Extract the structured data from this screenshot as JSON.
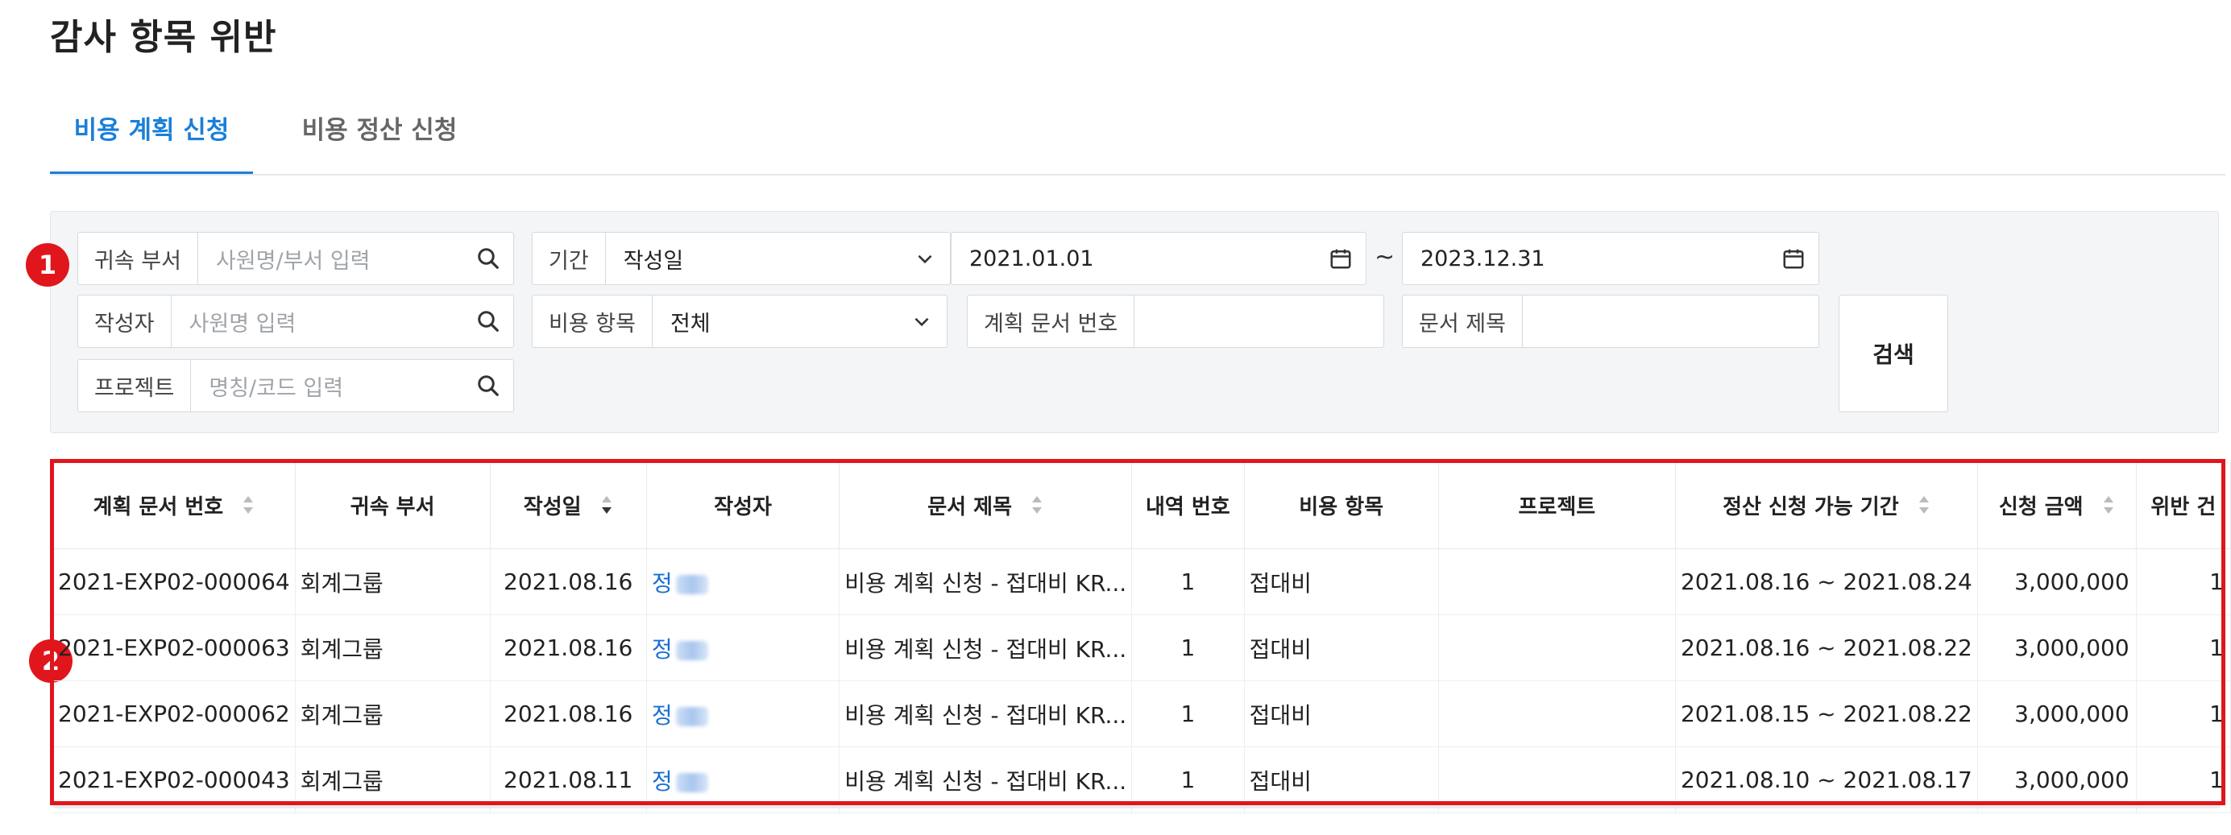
{
  "page": {
    "title": "감사 항목 위반"
  },
  "tabs": [
    {
      "label": "비용 계획 신청",
      "active": true
    },
    {
      "label": "비용 정산 신청",
      "active": false
    }
  ],
  "filters": {
    "department": {
      "label": "귀속 부서",
      "placeholder": "사원명/부서 입력"
    },
    "period": {
      "label": "기간",
      "type_value": "작성일",
      "start": "2021.01.01",
      "end": "2023.12.31",
      "separator": "~"
    },
    "author": {
      "label": "작성자",
      "placeholder": "사원명 입력"
    },
    "expense_item": {
      "label": "비용 항목",
      "value": "전체"
    },
    "plan_doc_no": {
      "label": "계획 문서 번호",
      "value": ""
    },
    "doc_title": {
      "label": "문서 제목",
      "value": ""
    },
    "project": {
      "label": "프로젝트",
      "placeholder": "명칭/코드 입력"
    },
    "search_button": "검색"
  },
  "annotations": {
    "badge1": "1",
    "badge2": "2"
  },
  "table": {
    "columns": [
      "계획 문서 번호",
      "귀속 부서",
      "작성일",
      "작성자",
      "문서 제목",
      "내역 번호",
      "비용 항목",
      "프로젝트",
      "정산 신청 가능 기간",
      "신청 금액",
      "위반 건"
    ],
    "rows": [
      {
        "doc_no": "2021-EXP02-000064",
        "dept": "회계그룹",
        "date": "2021.08.16",
        "author": "정",
        "title": "비용 계획 신청 - 접대비 KR...",
        "line_no": "1",
        "expense": "접대비",
        "project": "",
        "period": "2021.08.16 ~ 2021.08.24",
        "amount": "3,000,000",
        "violations": "1"
      },
      {
        "doc_no": "2021-EXP02-000063",
        "dept": "회계그룹",
        "date": "2021.08.16",
        "author": "정",
        "title": "비용 계획 신청 - 접대비 KR...",
        "line_no": "1",
        "expense": "접대비",
        "project": "",
        "period": "2021.08.16 ~ 2021.08.22",
        "amount": "3,000,000",
        "violations": "1"
      },
      {
        "doc_no": "2021-EXP02-000062",
        "dept": "회계그룹",
        "date": "2021.08.16",
        "author": "정",
        "title": "비용 계획 신청 - 접대비 KR...",
        "line_no": "1",
        "expense": "접대비",
        "project": "",
        "period": "2021.08.15 ~ 2021.08.22",
        "amount": "3,000,000",
        "violations": "1"
      },
      {
        "doc_no": "2021-EXP02-000043",
        "dept": "회계그룹",
        "date": "2021.08.11",
        "author": "정",
        "title": "비용 계획 신청 - 접대비 KR...",
        "line_no": "1",
        "expense": "접대비",
        "project": "",
        "period": "2021.08.10 ~ 2021.08.17",
        "amount": "3,000,000",
        "violations": "1"
      }
    ]
  },
  "colors": {
    "accent": "#1a7fd9",
    "link": "#1a6fd1",
    "highlight": "#e0161c"
  }
}
